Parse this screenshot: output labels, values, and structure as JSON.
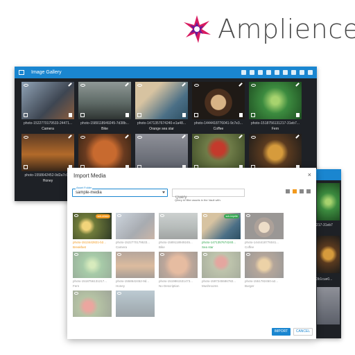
{
  "logo": {
    "text": "Amplience"
  },
  "gallery": {
    "title": "Image Gallery",
    "items": [
      {
        "file": "photo-1522770179533-24471...",
        "name": "Camera",
        "palette": "p-camera"
      },
      {
        "file": "photo-1589118949245-7d38b...",
        "name": "Bike",
        "palette": "p-bike"
      },
      {
        "file": "photo-1471357674240-e1a48...",
        "name": "Orange sea star",
        "palette": "p-star"
      },
      {
        "file": "photo-1444418776041-9c7e3...",
        "name": "Coffee",
        "palette": "p-coffee"
      },
      {
        "file": "photo-1518756131217-31eb7...",
        "name": "Fern",
        "palette": "p-fern"
      },
      {
        "file": "photo-1558642452-9d2a7c0...",
        "name": "Honey",
        "palette": "p-honey"
      },
      {
        "file": "",
        "name": "",
        "palette": "p-ball"
      },
      {
        "file": "",
        "name": "",
        "palette": "p-seal"
      },
      {
        "file": "",
        "name": "",
        "palette": "p-mush"
      },
      {
        "file": "",
        "name": "",
        "palette": "p-burger"
      }
    ]
  },
  "side": {
    "text1": "217-31eb7",
    "text2": "3b1cue0..."
  },
  "modal": {
    "title": "Import Media",
    "close": "×",
    "folder_label": "Asset Folder",
    "folder_value": "sample-media",
    "query_placeholder": "Query",
    "query_help": "Query to filter assets in the Vault with.",
    "import_label": "IMPORT",
    "cancel_label": "CANCEL",
    "items": [
      {
        "file": "photo-1513442821-b2...",
        "name": "Breakfast",
        "badge": "sub-refaim",
        "state": "sel-o",
        "palette": "p-break"
      },
      {
        "file": "photo-1522770179533...",
        "name": "Camera",
        "badge": "",
        "state": "",
        "palette": "p-camera"
      },
      {
        "file": "photo-1589118949245...",
        "name": "Bike",
        "badge": "",
        "state": "",
        "palette": "p-bike"
      },
      {
        "file": "photo-1471357674240...",
        "name": "Sea star",
        "badge": "sub-Imprite",
        "state": "sel-g",
        "palette": "p-star"
      },
      {
        "file": "photo-1444418776041...",
        "name": "Coffee",
        "badge": "",
        "state": "",
        "palette": "p-coffee"
      },
      {
        "file": "photo-1518756131217...",
        "name": "Fern",
        "badge": "",
        "state": "",
        "palette": "p-fern"
      },
      {
        "file": "photo-1558642452-9d...",
        "name": "Honey",
        "badge": "",
        "state": "",
        "palette": "p-honey"
      },
      {
        "file": "photo-1519861531473...",
        "name": "No Description",
        "badge": "",
        "state": "",
        "palette": "p-ball"
      },
      {
        "file": "photo-1597245586782...",
        "name": "Mushrooms",
        "badge": "",
        "state": "",
        "palette": "p-mush"
      },
      {
        "file": "photo-1551782450-a2...",
        "name": "Burger",
        "badge": "",
        "state": "",
        "palette": "p-burger"
      },
      {
        "file": "",
        "name": "",
        "badge": "",
        "state": "",
        "palette": "p-tomato"
      },
      {
        "file": "",
        "name": "",
        "badge": "",
        "state": "",
        "palette": "p-bike2"
      }
    ]
  }
}
